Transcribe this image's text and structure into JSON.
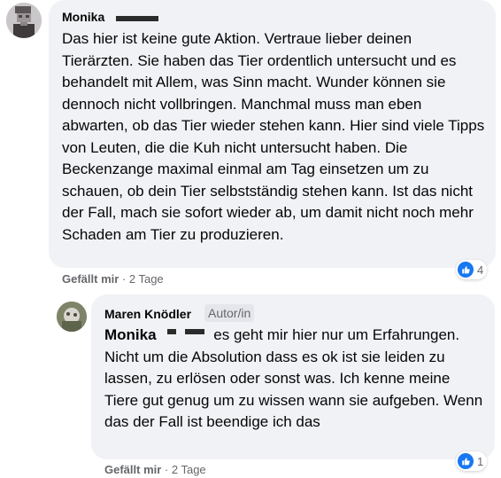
{
  "comment": {
    "author": "Monika",
    "text": "Das hier ist keine gute Aktion. Vertraue lieber deinen Tierärzten. Sie haben das Tier ordentlich untersucht und es behandelt mit Allem, was Sinn macht. Wunder können sie dennoch nicht vollbringen. Manchmal muss man eben abwarten, ob das Tier wieder stehen kann. Hier sind viele Tipps von Leuten, die die Kuh nicht untersucht haben. Die Beckenzange maximal einmal am Tag einsetzen um zu schauen, ob dein Tier selbstständig stehen kann. Ist das nicht der Fall, mach sie sofort wieder ab, um damit nicht noch mehr Schaden am Tier zu produzieren.",
    "like_label": "Gefällt mir",
    "separator": " · ",
    "time": "2 Tage",
    "reaction_count": "4"
  },
  "reply": {
    "author": "Maren Knödler",
    "badge": "Autor/in",
    "mention": "Monika",
    "text": " es geht mir hier nur um Erfahrungen. Nicht um die Absolution dass es ok ist sie leiden zu lassen, zu erlösen oder sonst was. Ich kenne meine Tiere gut genug um zu wissen wann sie aufgeben. Wenn das der Fall ist beendige ich das",
    "like_label": "Gefällt mir",
    "separator": " · ",
    "time": "2 Tage",
    "reaction_count": "1"
  },
  "icons": {
    "reaction": "thumbs-up-icon"
  },
  "colors": {
    "bubble_bg": "#f0f2f5",
    "secondary_text": "#65676b",
    "like_blue": "#1877f2"
  }
}
